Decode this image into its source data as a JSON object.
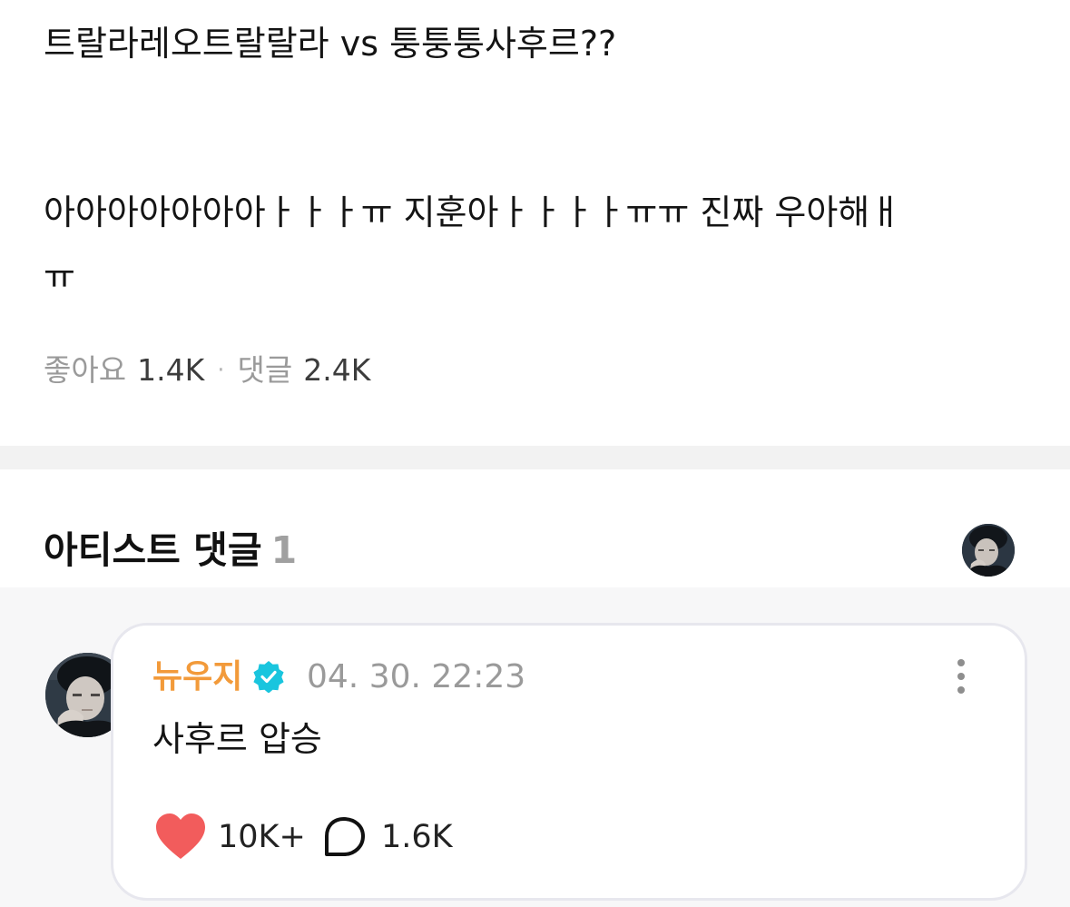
{
  "post": {
    "lines": [
      "트랄라레오트랄랄라 vs 퉁퉁퉁사후르??",
      "아아아아아아아ㅏㅏㅏㅠ 지훈아ㅏㅏㅏㅏㅠㅠ 진짜 우아해ㅐ",
      "ㅠ"
    ],
    "stats": {
      "likes_label": "좋아요",
      "likes_value": "1.4K",
      "separator": "·",
      "comments_label": "댓글",
      "comments_value": "2.4K"
    }
  },
  "artist_comments": {
    "title": "아티스트 댓글",
    "count": "1",
    "comments": [
      {
        "author": "뉴우지",
        "verified": true,
        "timestamp": "04. 30. 22:23",
        "text": "사후르 압승",
        "like_count": "10K+",
        "reply_count": "1.6K",
        "liked": true
      }
    ]
  },
  "icons": {
    "verified": "verified-badge-icon",
    "more": "more-vertical-icon",
    "like": "heart-icon",
    "reply": "speech-bubble-icon"
  },
  "colors": {
    "author": "#f29a3a",
    "verified": "#19c5de",
    "heart": "#f25c5c",
    "divider": "#f2f2f2",
    "comment_area": "#f7f7f8"
  }
}
